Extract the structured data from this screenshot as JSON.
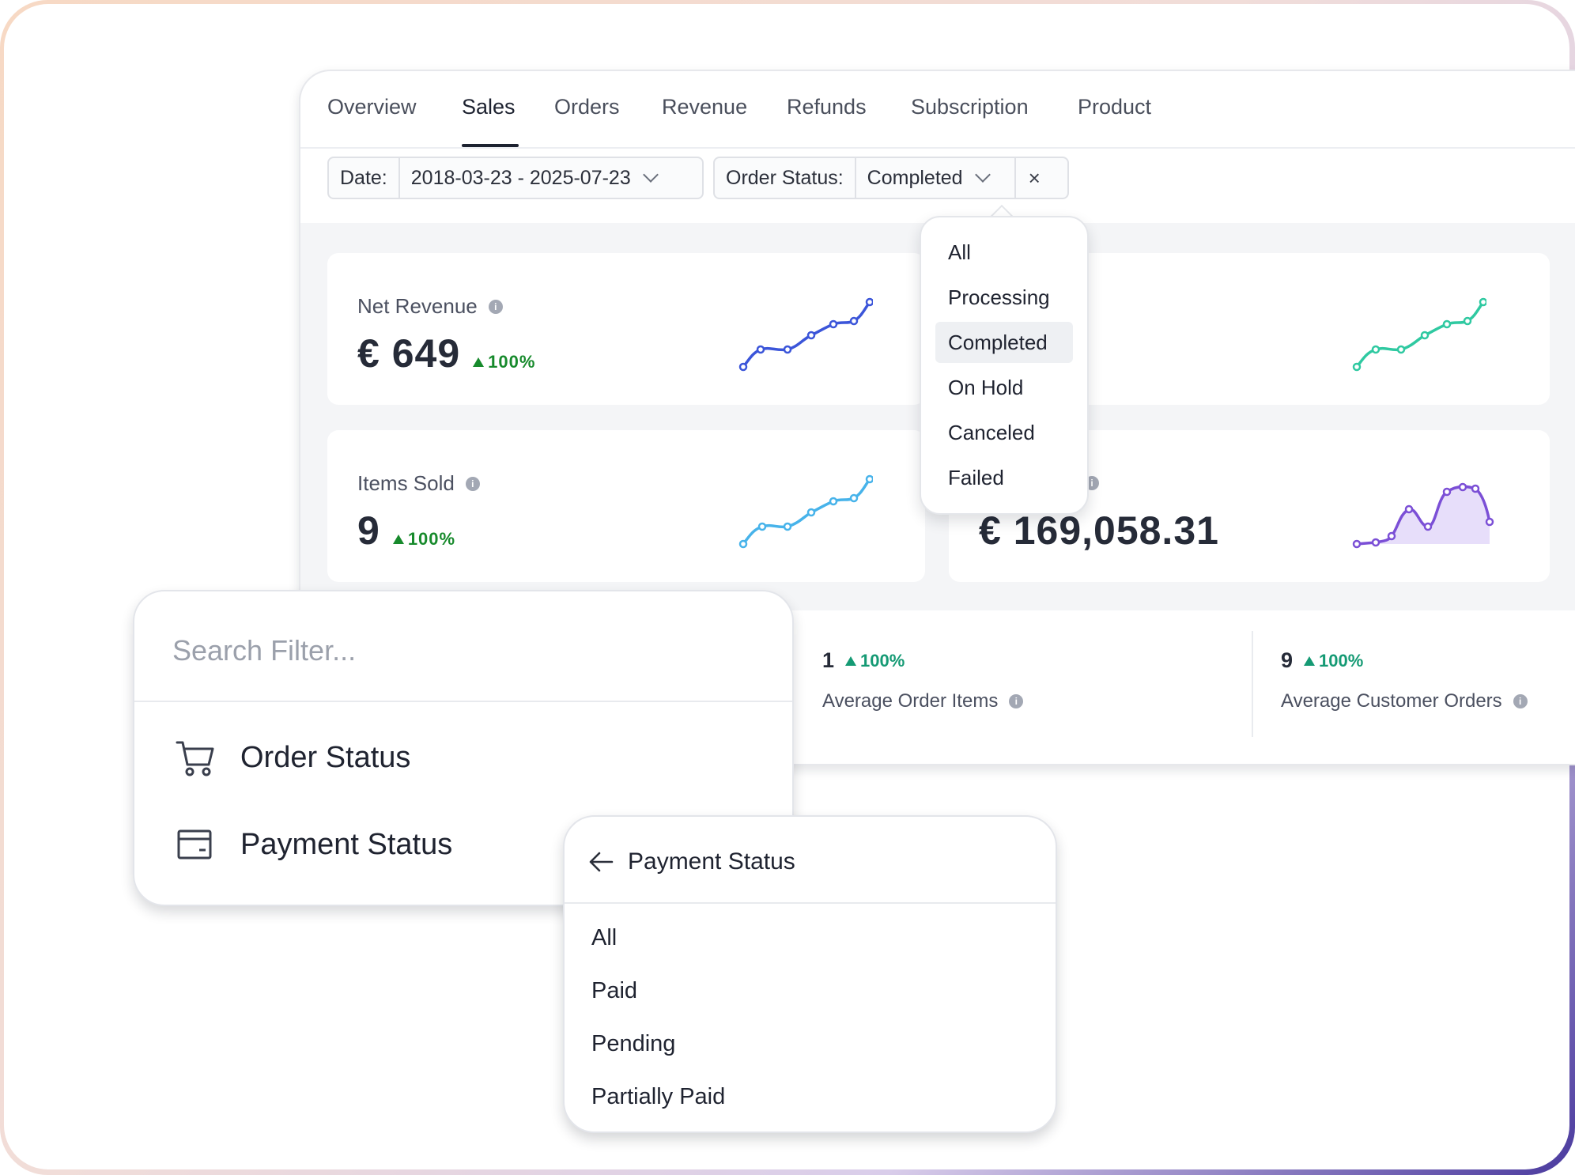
{
  "tabs": [
    "Overview",
    "Sales",
    "Orders",
    "Revenue",
    "Refunds",
    "Subscription",
    "Product"
  ],
  "active_tab": "Sales",
  "filters": {
    "date_label": "Date:",
    "date_value": "2018-03-23 - 2025-07-23",
    "order_status_label": "Order Status:",
    "order_status_value": "Completed",
    "clear_symbol": "×"
  },
  "cards": [
    {
      "label": "Net Revenue",
      "value": "€ 649",
      "delta": "100%",
      "spark_color": "#3b55d9"
    },
    {
      "label": "Items Sold",
      "value": "9",
      "delta": "100%",
      "spark_color": "#47b3ea"
    },
    {
      "label": "",
      "value": "",
      "delta": "",
      "spark_color": "#2fc9a1"
    },
    {
      "label": "",
      "value": "€ 169,058.31",
      "delta": "",
      "spark_color": "#7b4fd6"
    }
  ],
  "mini_stats": [
    {
      "value": "1",
      "delta": "100%",
      "label": "Average Order Items"
    },
    {
      "value": "9",
      "delta": "100%",
      "label": "Average Customer Orders"
    }
  ],
  "order_status_dropdown": {
    "options": [
      "All",
      "Processing",
      "Completed",
      "On Hold",
      "Canceled",
      "Failed"
    ],
    "selected": "Completed"
  },
  "search_filter": {
    "placeholder": "Search Filter...",
    "items": [
      {
        "label": "Order Status",
        "icon": "cart-icon"
      },
      {
        "label": "Payment Status",
        "icon": "card-icon"
      }
    ]
  },
  "payment_status": {
    "title": "Payment Status",
    "options": [
      "All",
      "Paid",
      "Pending",
      "Partially Paid"
    ]
  },
  "colors": {
    "up_green": "#178a2c",
    "teal_green": "#159a74",
    "text_dark": "#1f2330",
    "divider": "#e8eaee"
  }
}
